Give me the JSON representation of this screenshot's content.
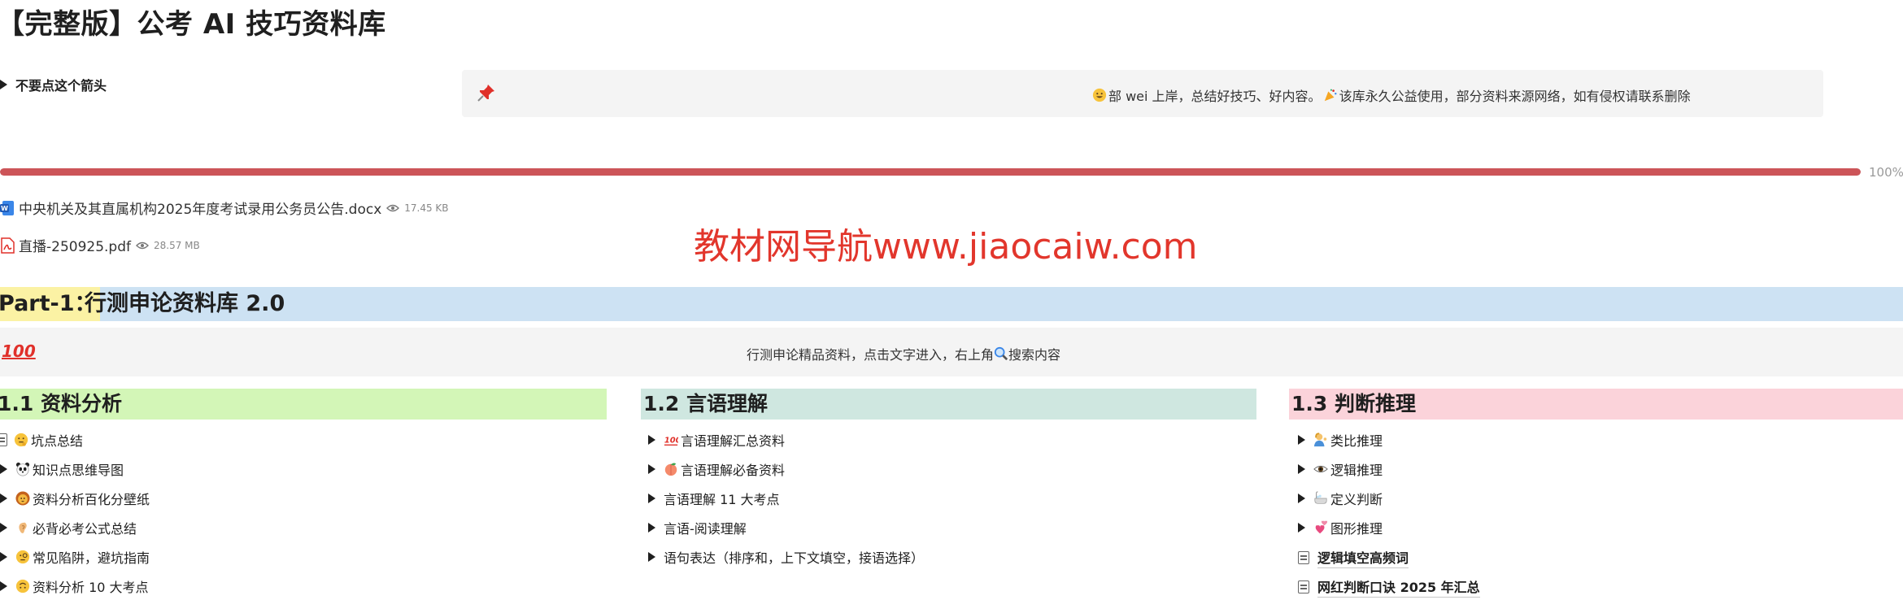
{
  "page_title": "【完整版】公考 AI 技巧资料库",
  "toggle_hint": "不要点这个箭头",
  "top_callout": {
    "icon": "pushpin-icon",
    "text1": "部 wei 上岸，总结好技巧、好内容。",
    "text2": "该库永久公益使用，部分资料来源网络，如有侵权请联系删除"
  },
  "progress": {
    "value_percent": 100,
    "label": "100%"
  },
  "files": [
    {
      "name": "中央机关及其直属机构2025年度考试录用公务员公告.docx",
      "size": "17.45 KB",
      "icon": "word-icon"
    },
    {
      "name": "直播-250925.pdf",
      "size": "28.57 MB",
      "icon": "pdf-icon"
    }
  ],
  "watermark": "教材网导航www.jiaocaiw.com",
  "part1": {
    "label": "Part-1：",
    "title": "行测申论资料库 2.0"
  },
  "mid_callout": {
    "icon": "hundred-points-icon",
    "text1": "行测申论精品资料，点击文字进入，右上角",
    "text2": "搜索内容"
  },
  "sections": [
    {
      "heading": "1.1 资料分析",
      "color": "#d3f6b7",
      "items": [
        {
          "label": "坑点总结",
          "icon": "thinking-face-icon",
          "kind": "page"
        },
        {
          "label": "知识点思维导图",
          "icon": "panda-icon",
          "kind": "toggle"
        },
        {
          "label": "资料分析百化分壁纸",
          "icon": "lion-icon",
          "kind": "toggle"
        },
        {
          "label": "必背必考公式总结",
          "icon": "ear-icon",
          "kind": "toggle"
        },
        {
          "label": "常见陷阱，避坑指南",
          "icon": "monocle-face-icon",
          "kind": "toggle"
        },
        {
          "label": "资料分析 10 大考点",
          "icon": "upside-down-face-icon",
          "kind": "toggle"
        }
      ]
    },
    {
      "heading": "1.2 言语理解",
      "color": "#cfe7e0",
      "items": [
        {
          "label": "言语理解汇总资料",
          "icon": "hundred-points-icon",
          "kind": "toggle"
        },
        {
          "label": "言语理解必备资料",
          "icon": "peach-icon",
          "kind": "toggle"
        },
        {
          "label": "言语理解 11 大考点",
          "icon": "",
          "kind": "toggle"
        },
        {
          "label": "言语-阅读理解",
          "icon": "",
          "kind": "toggle"
        },
        {
          "label": "语句表达（排序和，上下文填空，接语选择）",
          "icon": "",
          "kind": "toggle"
        }
      ]
    },
    {
      "heading": "1.3 判断推理",
      "color": "#fbd3da",
      "items": [
        {
          "label": "类比推理",
          "icon": "person-tipping-hand-icon",
          "kind": "toggle"
        },
        {
          "label": "逻辑推理",
          "icon": "eye-icon",
          "kind": "toggle"
        },
        {
          "label": "定义判断",
          "icon": "bathtub-icon",
          "kind": "toggle"
        },
        {
          "label": "图形推理",
          "icon": "two-hearts-icon",
          "kind": "toggle"
        },
        {
          "label": "逻辑填空高频词",
          "icon": "",
          "kind": "page"
        },
        {
          "label": "网红判断口诀 2025 年汇总",
          "icon": "",
          "kind": "page"
        }
      ]
    }
  ]
}
